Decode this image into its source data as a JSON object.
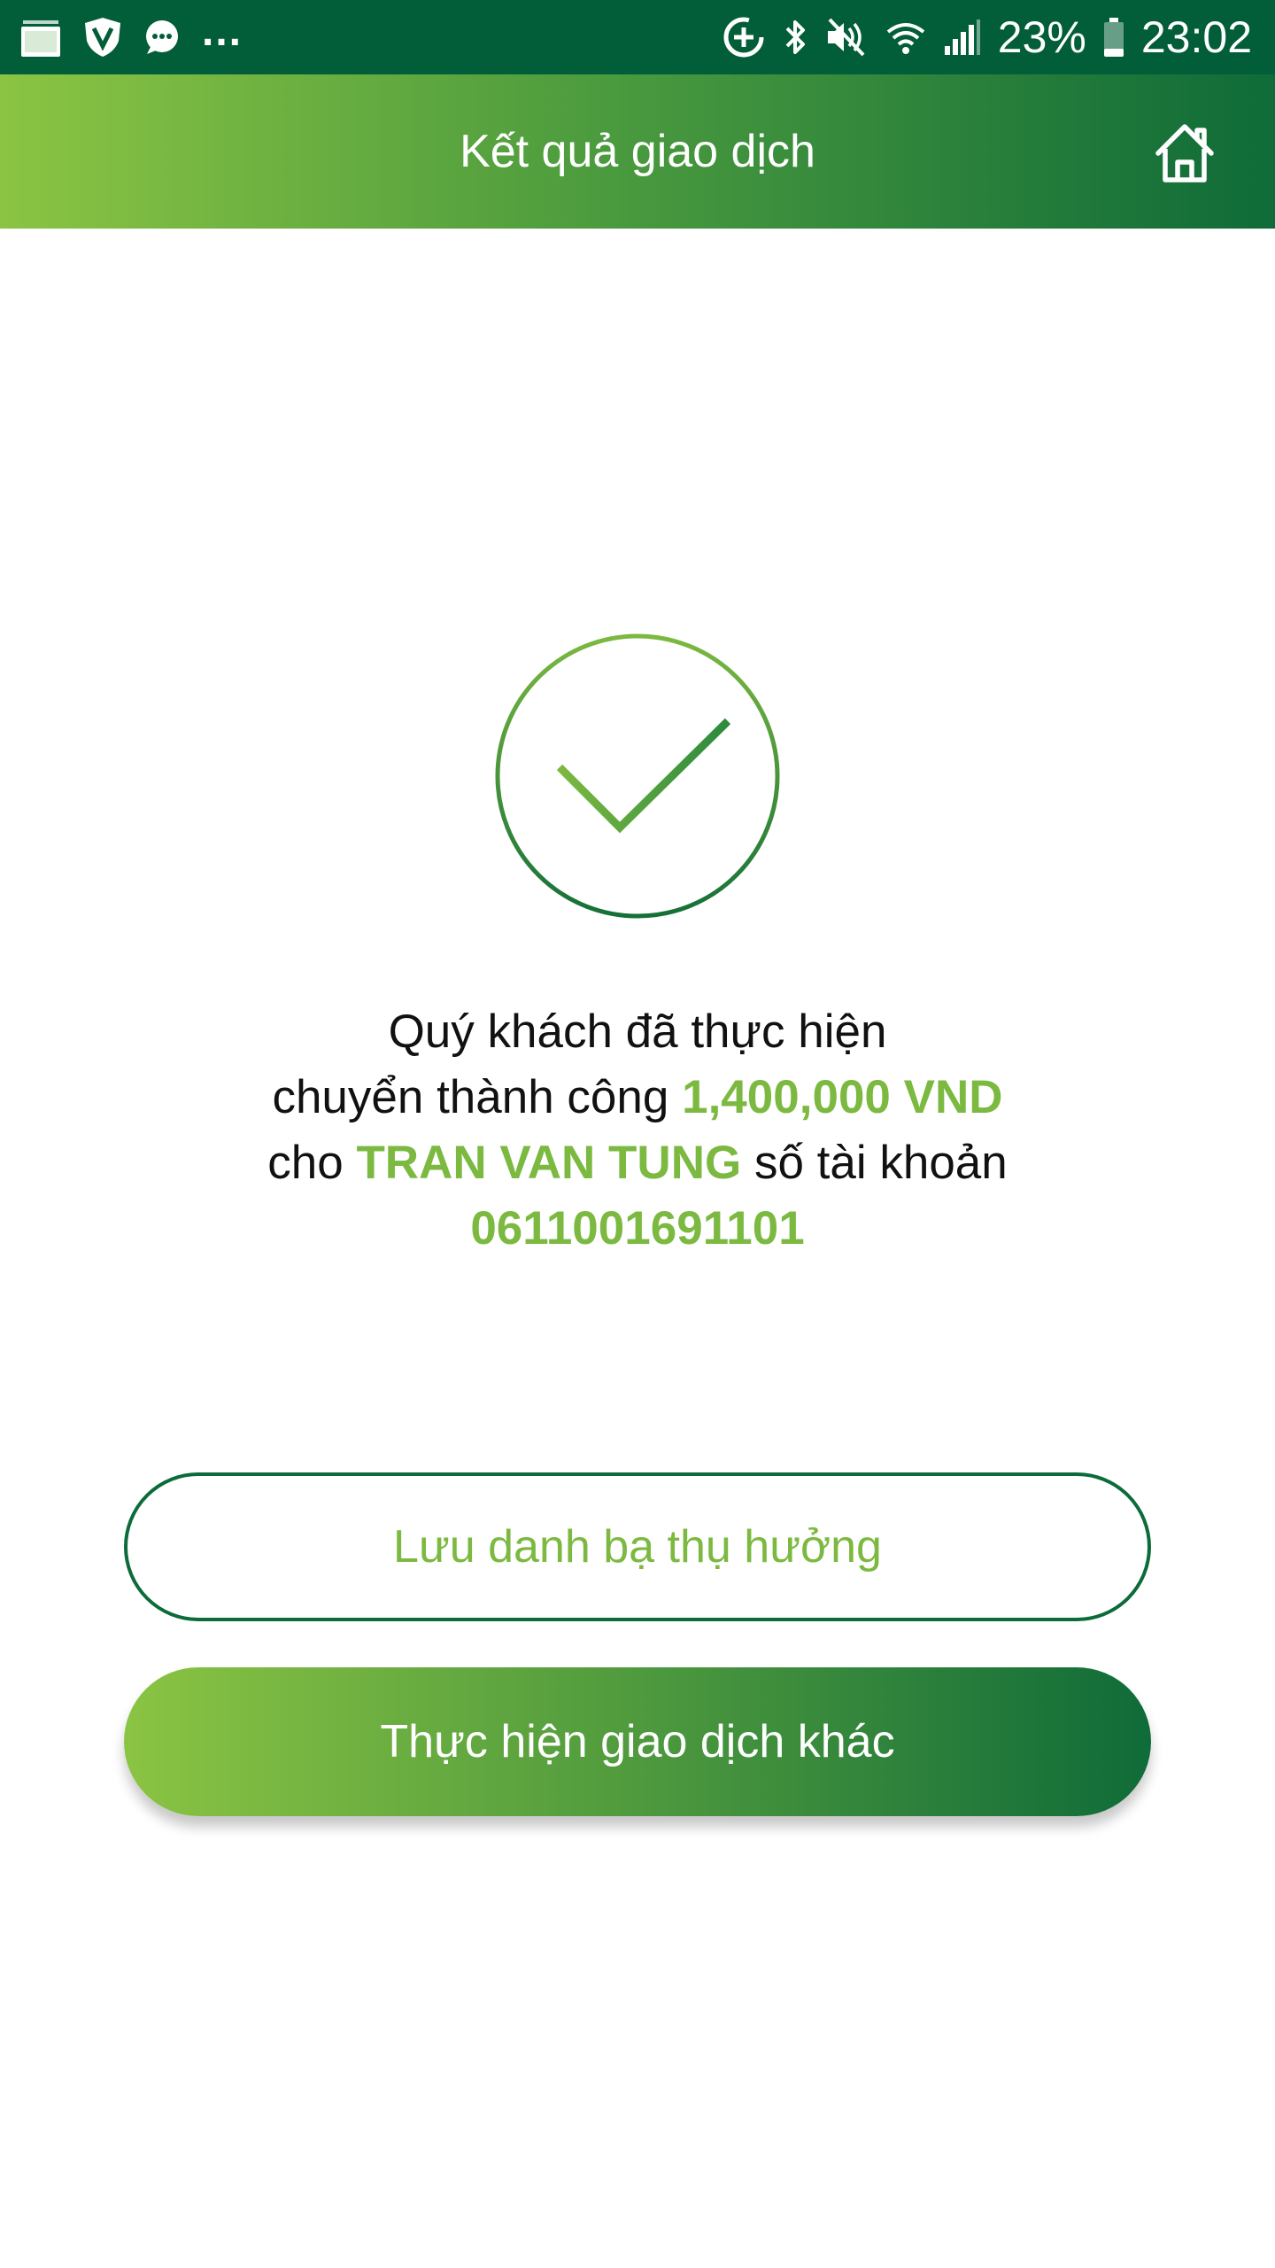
{
  "status_bar": {
    "left_icons": [
      "gallery-icon",
      "shield-v-icon",
      "chat-bubble-icon"
    ],
    "more": "...",
    "right_icons": [
      "data-saver-icon",
      "bluetooth-icon",
      "mute-icon",
      "wifi-icon",
      "signal-icon",
      "battery-icon"
    ],
    "battery": "23%",
    "time": "23:02"
  },
  "header": {
    "title": "Kết quả giao dịch",
    "home_icon": "home-icon"
  },
  "result": {
    "icon": "check-circle-icon",
    "line1": "Quý khách đã thực hiện",
    "line2_prefix": "chuyển thành công",
    "amount": "1,400,000 VND",
    "line3_prefix": "cho",
    "recipient": "TRAN VAN TUNG",
    "line3_suffix": "số tài khoản",
    "account_number": "0611001691101"
  },
  "actions": {
    "save_contact_label": "Lưu danh bạ thụ hưởng",
    "new_transaction_label": "Thực hiện giao dịch khác"
  },
  "colors": {
    "status_bar": "#025e38",
    "accent_light": "#8bc443",
    "accent_dark": "#0f6b38",
    "highlight_text": "#7cb940"
  }
}
